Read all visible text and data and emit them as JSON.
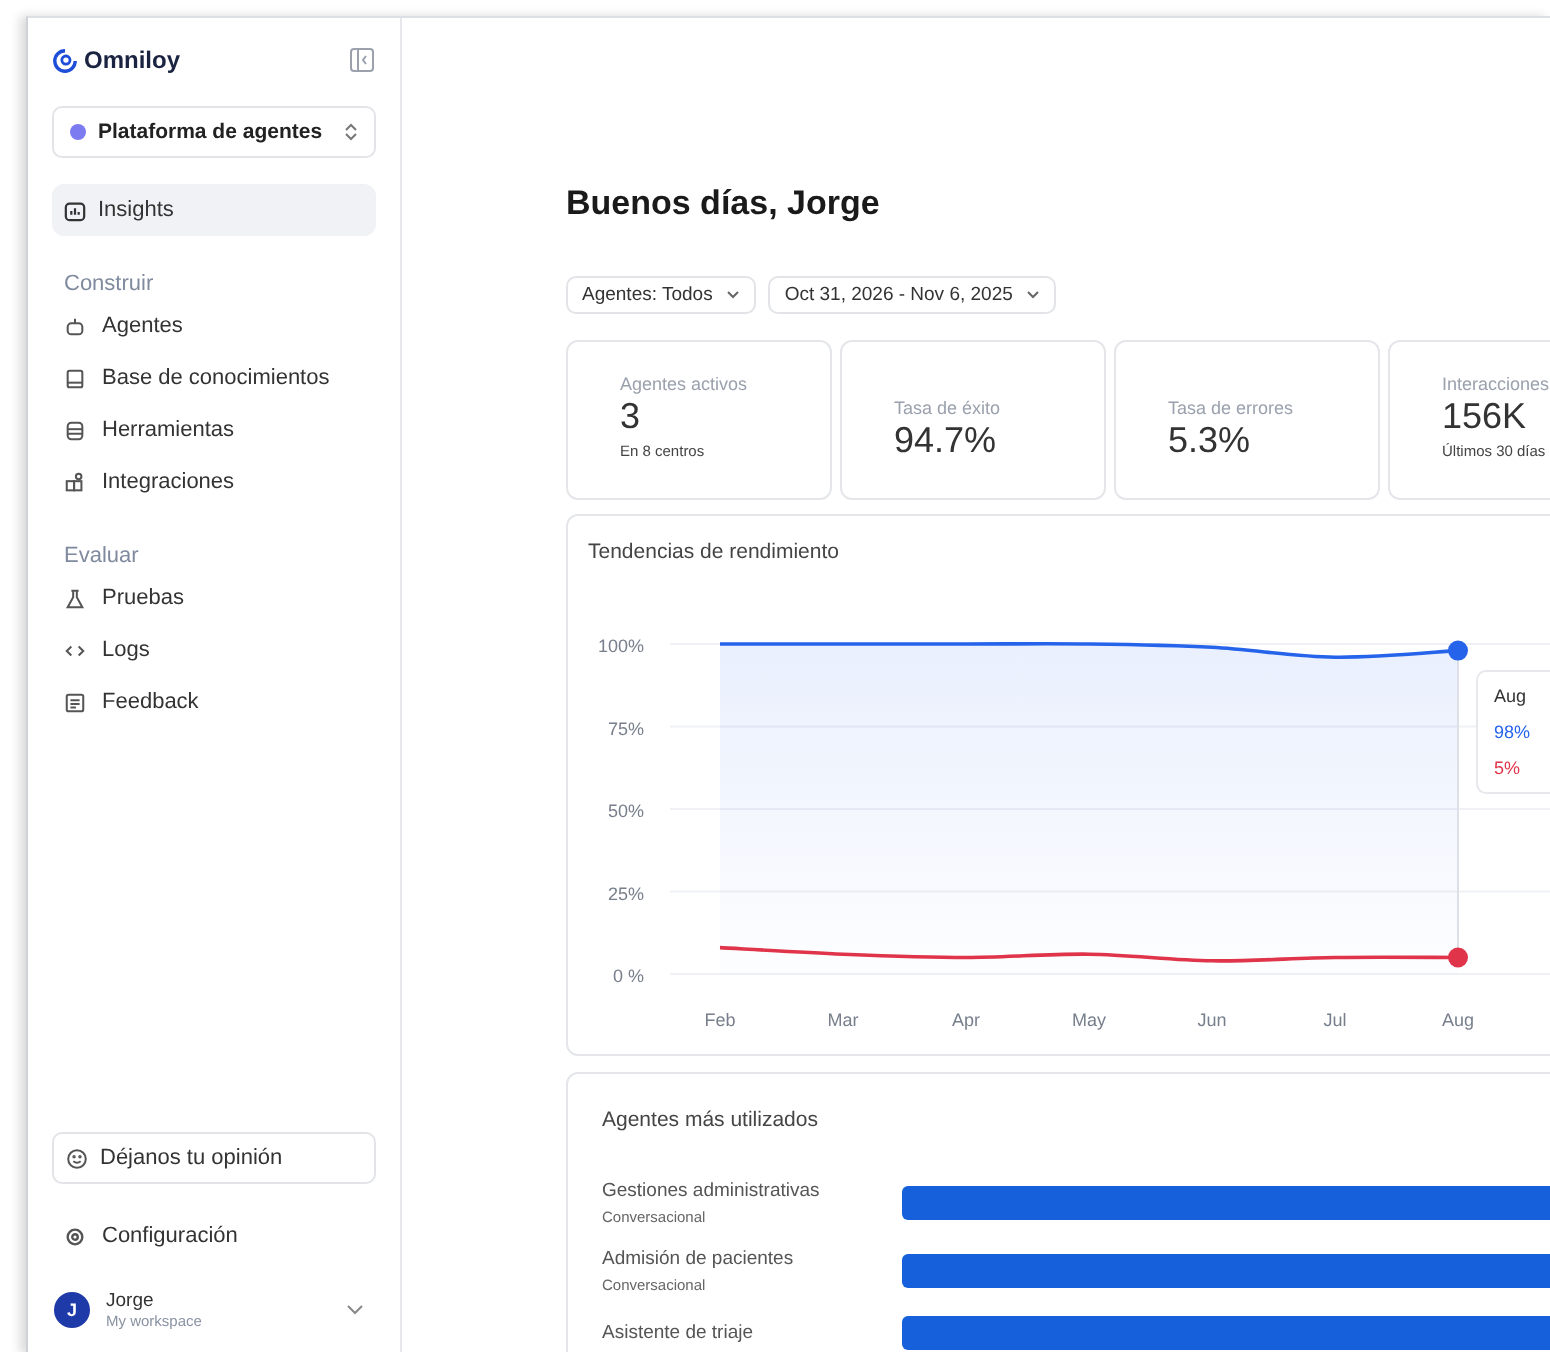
{
  "sidebar": {
    "brand": "Omniloy",
    "workspace_selector": "Plataforma de agentes",
    "items": [
      {
        "label": "Insights",
        "selected": true
      }
    ],
    "sections": [
      {
        "title": "Construir",
        "items": [
          {
            "label": "Agentes",
            "selected": false
          },
          {
            "label": "Base de conocimientos",
            "selected": false
          },
          {
            "label": "Herramientas",
            "selected": false
          },
          {
            "label": "Integraciones",
            "selected": false
          }
        ]
      },
      {
        "title": "Evaluar",
        "items": [
          {
            "label": "Pruebas",
            "selected": false
          },
          {
            "label": "Logs",
            "selected": false
          },
          {
            "label": "Feedback",
            "selected": false
          }
        ]
      }
    ],
    "feedback_button": "Déjanos tu opinión",
    "settings": "Configuración",
    "user": {
      "initial": "J",
      "name": "Jorge",
      "workspace": "My workspace"
    }
  },
  "main": {
    "greeting": "Buenos días, Jorge",
    "filters": [
      "Agentes: Todos",
      "Oct 31, 2026 - Nov 6, 2025"
    ],
    "stats": [
      {
        "label": "Agentes activos",
        "value": "3",
        "note": "En 8 centros"
      },
      {
        "label": "Tasa de éxito",
        "value": "94.7%"
      },
      {
        "label": "Tasa de errores",
        "value": "5.3%"
      },
      {
        "label": "Interacciones",
        "value": "156K",
        "note": "Últimos 30 días"
      }
    ],
    "performance": {
      "title": "Tendencias de rendimiento",
      "chart_data": {
        "type": "line",
        "categories": [
          "Feb",
          "Mar",
          "Apr",
          "May",
          "Jun",
          "Jul",
          "Aug"
        ],
        "series": [
          {
            "color": "#2563eb",
            "values": [
              100,
              100,
              100,
              100,
              99,
              96,
              98
            ]
          },
          {
            "color": "#e0344a",
            "values": [
              8,
              6,
              5,
              6,
              4,
              5,
              5
            ]
          }
        ],
        "ylim": [
          0,
          100
        ],
        "grid": true,
        "yticks": [
          {
            "value": 0,
            "label": "0 %"
          },
          {
            "value": 25,
            "label": "25%"
          },
          {
            "value": 50,
            "label": "50%"
          },
          {
            "value": 75,
            "label": "75%"
          },
          {
            "value": 100,
            "label": "100%"
          }
        ]
      },
      "tooltip": {
        "label": "Aug",
        "values": [
          "98%",
          "5%"
        ]
      }
    },
    "top_agents": {
      "title": "Agentes más utilizados",
      "agents": [
        {
          "name": "Gestiones administrativas",
          "type": "Conversacional"
        },
        {
          "name": "Admisión de pacientes",
          "type": "Conversacional"
        },
        {
          "name": "Asistente de triaje"
        }
      ]
    }
  }
}
